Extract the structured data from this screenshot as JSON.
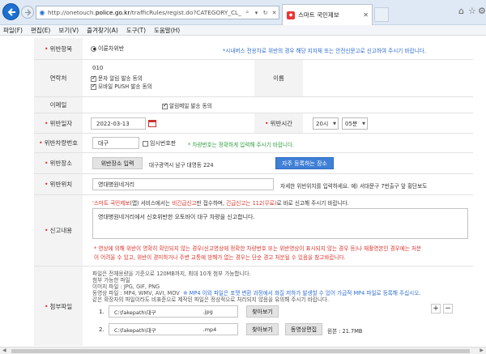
{
  "browser": {
    "url_prefix": "http://onetouch.",
    "url_domain": "police.go.kr",
    "url_suffix": "/trafficRules/regist.do?CATEGORY_CL_",
    "tab_title": "스마트 국민제보",
    "menu": [
      "파일(F)",
      "편집(E)",
      "보기(V)",
      "즐겨찾기(A)",
      "도구(T)",
      "도움말(H)"
    ]
  },
  "form": {
    "violation_type": {
      "label": "위반항목",
      "value": "이륜차위반",
      "notice": "*시내버스 전용차로 위반의 경우 해당 지자체 또는 안전신문고로 신고하여 주시기 바랍니다."
    },
    "contact": {
      "label": "연락처",
      "phone": "010",
      "sms_consent": "문자 알림 발송 동의",
      "push_consent": "모바일 PUSH 발송 동의",
      "name_label": "이름"
    },
    "email": {
      "label": "이메일",
      "mail_consent": "알림메일 발송 동의"
    },
    "violation_date": {
      "label": "위반일자",
      "value": "2022-03-13",
      "time_label": "위반시간",
      "hour": "20시",
      "minute": "05분"
    },
    "vehicle_number": {
      "label": "위반차량번호",
      "value": "대구",
      "temp_plate": "임시번호판",
      "notice": "* 차량번호는 정확하게 입력해 주시기 바랍니다."
    },
    "violation_place": {
      "label": "위반장소",
      "input_button": "위반장소 입력",
      "address": "대구광역시 남구 대명동 224",
      "frequent_button": "자주 등록하는 장소"
    },
    "violation_location": {
      "label": "위반위치",
      "value": "영대병원네거리",
      "hint": "자세한 위반위치를 입력하세요. 예) 서대문구 7번출구 앞 횡단보도"
    },
    "report": {
      "label": "신고내용",
      "notice_a": "'스마트 국민제보",
      "notice_b": "(앱)",
      "notice_c": " 서비스에서는 ",
      "notice_d": "비긴급신고",
      "notice_e": "만 접수하며, ",
      "notice_f": "긴급신고는 112(무료)",
      "notice_g": "로 바로 신고해 주시기 바랍니다.",
      "content": "영대병원네거리에서 신호위반한 오토바이 대구                    차량을 신고합니다.",
      "warning_1": "* 영상에 의해 위반이 명확히 확인되지 않는 경우(신고영상에 정확한 차량번호 또는 위반영상이 표시되지 않는 경우 등)나 재촬영본인 경우에는 처분",
      "warning_2": "이 어려울 수 있고, 위반이 경미하거나 주변 교통에 방해가 없는 경우는 단순 경고 처분될 수 있음을 참고바랍니다."
    },
    "attachments": {
      "label": "첨부파일",
      "info_1": "파일은 전체용량을 기준으로 120MB까지, 최대 10개 첨부 가능합니다.",
      "info_2": "첨부 가능한 파일",
      "info_3": "이미지 파일 : JPG, GIF, PNG",
      "info_4_a": "동영상 파일 : MP4, WMV, AVI, MOV",
      "info_4_b": "※ MP4 이외 파일은 포맷 변환 과정에서 화질 저하가 발생할 수 있어 가급적 MP4 파일로 등록해 주십시오.",
      "info_5": "같은 확장자의 파일이라도 비표준으로 제작된 파일은 정상적으로 처리되지 않음을 유의해 주시기 바랍니다.",
      "add_label": "+",
      "remove_label": "−",
      "files": [
        {
          "index": "1.",
          "path": "C:\\fakepath\\대구",
          "ext": ".jpg",
          "browse": "찾아보기"
        },
        {
          "index": "2.",
          "path": "C:\\fakepath\\대구",
          "ext": ".mp4",
          "browse": "찾아보기",
          "edit": "동영상편집",
          "size": "원본 : 21.7MB"
        }
      ]
    }
  }
}
